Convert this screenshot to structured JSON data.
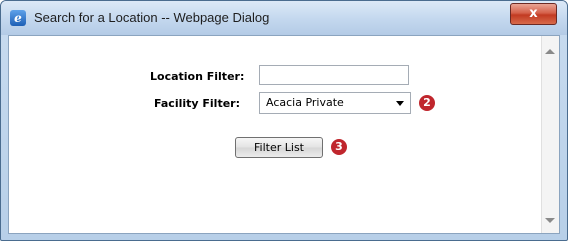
{
  "window": {
    "title": "Search for a Location -- Webpage Dialog",
    "close_label": "x",
    "app_icon_glyph": "e"
  },
  "form": {
    "location_label": "Location Filter:",
    "location_value": "",
    "facility_label": "Facility Filter:",
    "facility_selected": "Acacia Private",
    "filter_button_label": "Filter List"
  },
  "callouts": {
    "facility_badge": "2",
    "filter_badge": "3"
  },
  "colors": {
    "badge": "#c0262d",
    "close_button": "#c23a22",
    "frame": "#b7cfe8"
  },
  "icons": [
    "ie-icon",
    "close-icon",
    "chevron-down-icon",
    "scroll-up-icon",
    "scroll-down-icon"
  ]
}
